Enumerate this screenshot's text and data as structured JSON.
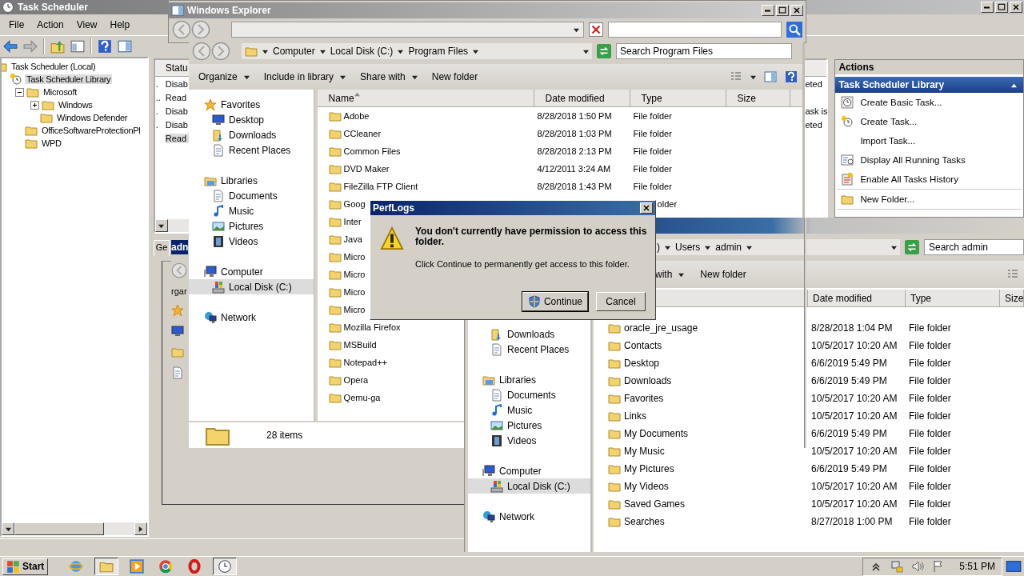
{
  "task_scheduler": {
    "title": "Task Scheduler",
    "menu": [
      "File",
      "Action",
      "View",
      "Help"
    ],
    "tree": [
      {
        "label": "Task Scheduler (Local)",
        "selected": false,
        "children": [
          {
            "label": "Task Scheduler Library",
            "selected": true,
            "children": [
              {
                "label": "Microsoft",
                "selected": false,
                "expanded": true,
                "children": [
                  {
                    "label": "Windows",
                    "selected": false,
                    "expanded": false
                  },
                  {
                    "label": "Windows Defender",
                    "selected": false
                  }
                ]
              },
              {
                "label": "OfficeSoftwareProtectionPl",
                "selected": false
              },
              {
                "label": "WPD",
                "selected": false
              }
            ]
          }
        ]
      }
    ],
    "task_table": {
      "column_1": "Statu",
      "rows": [
        {
          "column_0": ".",
          "status": "Disab",
          "column_last": "eted",
          "selected": false
        },
        {
          "column_0": "..",
          "status": "Read",
          "selected": false
        },
        {
          "column_0": ".",
          "status": "Disab",
          "column_last": "ask is",
          "selected": false
        },
        {
          "column_0": ".",
          "status": "Disab",
          "column_last": "eted",
          "selected": false
        },
        {
          "status": "Read",
          "selected": true
        }
      ]
    },
    "details_tab": "Ge",
    "actions": {
      "header": "Actions",
      "section": "Task Scheduler Library",
      "expanded": true,
      "items": [
        "Create Basic Task...",
        "Create Task...",
        "Import Task...",
        "Display All Running Tasks",
        "Enable All Tasks History",
        "New Folder..."
      ]
    }
  },
  "background_window": {
    "title_fragment": "adn",
    "toolbar_fragment": "rgar"
  },
  "explorer": {
    "title": "Windows Explorer",
    "breadcrumb": [
      "Computer",
      "Local Disk (C:)",
      "Program Files"
    ],
    "search": {
      "placeholder": "Search Program Files"
    },
    "toolbar": [
      {
        "label": "Organize",
        "dropdown": true
      },
      {
        "label": "Include in library",
        "dropdown": true
      },
      {
        "label": "Share with",
        "dropdown": true
      },
      {
        "label": "New folder",
        "dropdown": false
      }
    ],
    "nav": [
      {
        "label": "Favorites",
        "kind": "group",
        "selected": false
      },
      {
        "label": "Desktop",
        "kind": "item",
        "selected": false
      },
      {
        "label": "Downloads",
        "kind": "item",
        "selected": false
      },
      {
        "label": "Recent Places",
        "kind": "item",
        "selected": false
      },
      {
        "label": "Libraries",
        "kind": "group",
        "selected": false
      },
      {
        "label": "Documents",
        "kind": "item",
        "selected": false
      },
      {
        "label": "Music",
        "kind": "item",
        "selected": false
      },
      {
        "label": "Pictures",
        "kind": "item",
        "selected": false
      },
      {
        "label": "Videos",
        "kind": "item",
        "selected": false
      },
      {
        "label": "Computer",
        "kind": "group",
        "selected": false
      },
      {
        "label": "Local Disk (C:)",
        "kind": "item",
        "selected": true
      },
      {
        "label": "Network",
        "kind": "group",
        "selected": false
      }
    ],
    "columns": [
      {
        "label": "Name",
        "sorted": true
      },
      {
        "label": "Date modified",
        "sorted": false
      },
      {
        "label": "Type",
        "sorted": false
      },
      {
        "label": "Size",
        "sorted": false
      }
    ],
    "rows": [
      {
        "name": "Adobe",
        "date": "8/28/2018 1:50 PM",
        "type": "File folder"
      },
      {
        "name": "CCleaner",
        "date": "8/28/2018 1:03 PM",
        "type": "File folder"
      },
      {
        "name": "Common Files",
        "date": "8/28/2018 2:13 PM",
        "type": "File folder"
      },
      {
        "name": "DVD Maker",
        "date": "4/12/2011 3:24 AM",
        "type": "File folder"
      },
      {
        "name": "FileZilla FTP Client",
        "date": "8/28/2018 1:43 PM",
        "type": "File folder"
      },
      {
        "name": "Goog",
        "type_tail": "older"
      },
      {
        "name": "Inter"
      },
      {
        "name": "Java"
      },
      {
        "name": "Micro"
      },
      {
        "name": "Micro"
      },
      {
        "name": "Micro"
      },
      {
        "name": "Micro"
      },
      {
        "name": "Mozilla Firefox"
      },
      {
        "name": "MSBuild"
      },
      {
        "name": "Notepad++"
      },
      {
        "name": "Opera"
      },
      {
        "name": "Qemu-ga"
      }
    ],
    "status": "28 items"
  },
  "admin_window": {
    "breadcrumb": [
      ")",
      "Users",
      "admin"
    ],
    "search": {
      "placeholder": "Search admin"
    },
    "toolbar": [
      {
        "label": "with",
        "dropdown": true
      },
      {
        "label": "New folder",
        "dropdown": false
      }
    ],
    "nav": [
      {
        "label": "Downloads",
        "kind": "item",
        "selected": false
      },
      {
        "label": "Recent Places",
        "kind": "item",
        "selected": false
      },
      {
        "label": "Libraries",
        "kind": "group",
        "selected": false
      },
      {
        "label": "Documents",
        "kind": "item",
        "selected": false
      },
      {
        "label": "Music",
        "kind": "item",
        "selected": false
      },
      {
        "label": "Pictures",
        "kind": "item",
        "selected": false
      },
      {
        "label": "Videos",
        "kind": "item",
        "selected": false
      },
      {
        "label": "Computer",
        "kind": "group",
        "selected": false
      },
      {
        "label": "Local Disk (C:)",
        "kind": "item",
        "selected": true
      },
      {
        "label": "Network",
        "kind": "group",
        "selected": false
      }
    ],
    "columns": [
      "Date modified",
      "Type",
      "Size"
    ],
    "rows": [
      {
        "name": "oracle_jre_usage",
        "date": "8/28/2018 1:04 PM",
        "type": "File folder"
      },
      {
        "name": "Contacts",
        "date": "10/5/2017 10:20 AM",
        "type": "File folder"
      },
      {
        "name": "Desktop",
        "date": "6/6/2019 5:49 PM",
        "type": "File folder"
      },
      {
        "name": "Downloads",
        "date": "6/6/2019 5:49 PM",
        "type": "File folder"
      },
      {
        "name": "Favorites",
        "date": "10/5/2017 10:20 AM",
        "type": "File folder"
      },
      {
        "name": "Links",
        "date": "10/5/2017 10:20 AM",
        "type": "File folder"
      },
      {
        "name": "My Documents",
        "date": "6/6/2019 5:49 PM",
        "type": "File folder"
      },
      {
        "name": "My Music",
        "date": "10/5/2017 10:20 AM",
        "type": "File folder"
      },
      {
        "name": "My Pictures",
        "date": "6/6/2019 5:49 PM",
        "type": "File folder"
      },
      {
        "name": "My Videos",
        "date": "10/5/2017 10:20 AM",
        "type": "File folder"
      },
      {
        "name": "Saved Games",
        "date": "10/5/2017 10:20 AM",
        "type": "File folder"
      },
      {
        "name": "Searches",
        "date": "8/27/2018 1:00 PM",
        "type": "File folder"
      }
    ]
  },
  "dialog": {
    "title": "PerfLogs",
    "message": "You don't currently have permission to access this folder.",
    "detail": "Click Continue to permanently get access to this folder.",
    "buttons": [
      {
        "label": "Continue",
        "kind": "elevated",
        "default": true
      },
      {
        "label": "Cancel",
        "kind": "plain",
        "default": false
      }
    ]
  },
  "taskbar": {
    "start": "Start",
    "apps": [
      {
        "active": false
      },
      {
        "active": true
      },
      {
        "active": false
      },
      {
        "active": false
      },
      {
        "active": false
      },
      {
        "active": true
      }
    ],
    "clock": "5:51 PM"
  }
}
